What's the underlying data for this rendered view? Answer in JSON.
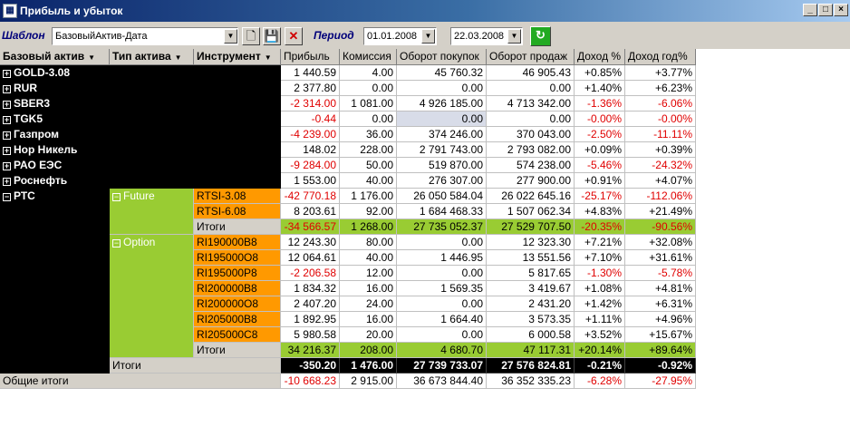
{
  "window": {
    "title": "Прибыль и убыток",
    "min": "_",
    "max": "□",
    "close": "×"
  },
  "toolbar": {
    "template_label": "Шаблон",
    "template_value": "БазовыйАктив-Дата",
    "period_label": "Период",
    "date_from": "01.01.2008",
    "date_to": "22.03.2008"
  },
  "headers": {
    "base": "Базовый актив",
    "type": "Тип актива",
    "instrument": "Инструмент",
    "profit": "Прибыль",
    "commission": "Комиссия",
    "buy": "Оборот покупок",
    "sell": "Оборот продаж",
    "yield": "Доход %",
    "yield_year": "Доход год%"
  },
  "top_rows": [
    {
      "name": "GOLD-3.08",
      "v": [
        "1 440.59",
        "4.00",
        "45 760.32",
        "46 905.43",
        "+0.85%",
        "+3.77%"
      ]
    },
    {
      "name": "RUR",
      "v": [
        "2 377.80",
        "0.00",
        "0.00",
        "0.00",
        "+1.40%",
        "+6.23%"
      ]
    },
    {
      "name": "SBER3",
      "v": [
        "-2 314.00",
        "1 081.00",
        "4 926 185.00",
        "4 713 342.00",
        "-1.36%",
        "-6.06%"
      ]
    },
    {
      "name": "TGK5",
      "v": [
        "-0.44",
        "0.00",
        "0.00",
        "0.00",
        "-0.00%",
        "-0.00%"
      ]
    },
    {
      "name": "Газпром",
      "v": [
        "-4 239.00",
        "36.00",
        "374 246.00",
        "370 043.00",
        "-2.50%",
        "-11.11%"
      ]
    },
    {
      "name": "Нор Никель",
      "v": [
        "148.02",
        "228.00",
        "2 791 743.00",
        "2 793 082.00",
        "+0.09%",
        "+0.39%"
      ]
    },
    {
      "name": "РАО ЕЭС",
      "v": [
        "-9 284.00",
        "50.00",
        "519 870.00",
        "574 238.00",
        "-5.46%",
        "-24.32%"
      ]
    },
    {
      "name": "Роснефть",
      "v": [
        "1 553.00",
        "40.00",
        "276 307.00",
        "277 900.00",
        "+0.91%",
        "+4.07%"
      ]
    }
  ],
  "rts": {
    "name": "РТС",
    "future": "Future",
    "option": "Option",
    "total_label": "Итоги"
  },
  "future_rows": [
    {
      "name": "RTSI-3.08",
      "v": [
        "-42 770.18",
        "1 176.00",
        "26 050 584.04",
        "26 022 645.16",
        "-25.17%",
        "-112.06%"
      ]
    },
    {
      "name": "RTSI-6.08",
      "v": [
        "8 203.61",
        "92.00",
        "1 684 468.33",
        "1 507 062.34",
        "+4.83%",
        "+21.49%"
      ]
    }
  ],
  "future_total": [
    "-34 566.57",
    "1 268.00",
    "27 735 052.37",
    "27 529 707.50",
    "-20.35%",
    "-90.56%"
  ],
  "option_rows": [
    {
      "name": "RI190000B8",
      "v": [
        "12 243.30",
        "80.00",
        "0.00",
        "12 323.30",
        "+7.21%",
        "+32.08%"
      ]
    },
    {
      "name": "RI195000O8",
      "v": [
        "12 064.61",
        "40.00",
        "1 446.95",
        "13 551.56",
        "+7.10%",
        "+31.61%"
      ]
    },
    {
      "name": "RI195000P8",
      "v": [
        "-2 206.58",
        "12.00",
        "0.00",
        "5 817.65",
        "-1.30%",
        "-5.78%"
      ]
    },
    {
      "name": "RI200000B8",
      "v": [
        "1 834.32",
        "16.00",
        "1 569.35",
        "3 419.67",
        "+1.08%",
        "+4.81%"
      ]
    },
    {
      "name": "RI200000O8",
      "v": [
        "2 407.20",
        "24.00",
        "0.00",
        "2 431.20",
        "+1.42%",
        "+6.31%"
      ]
    },
    {
      "name": "RI205000B8",
      "v": [
        "1 892.95",
        "16.00",
        "1 664.40",
        "3 573.35",
        "+1.11%",
        "+4.96%"
      ]
    },
    {
      "name": "RI205000C8",
      "v": [
        "5 980.58",
        "20.00",
        "0.00",
        "6 000.58",
        "+3.52%",
        "+15.67%"
      ]
    }
  ],
  "option_total": [
    "34 216.37",
    "208.00",
    "4 680.70",
    "47 117.31",
    "+20.14%",
    "+89.64%"
  ],
  "rts_total": [
    "-350.20",
    "1 476.00",
    "27 739 733.07",
    "27 576 824.81",
    "-0.21%",
    "-0.92%"
  ],
  "grand_total": {
    "label": "Общие итоги",
    "v": [
      "-10 668.23",
      "2 915.00",
      "36 673 844.40",
      "36 352 335.23",
      "-6.28%",
      "-27.95%"
    ]
  },
  "colors": {
    "orange": "#ff9900",
    "green": "#99cc33",
    "negative": "#e00000"
  }
}
